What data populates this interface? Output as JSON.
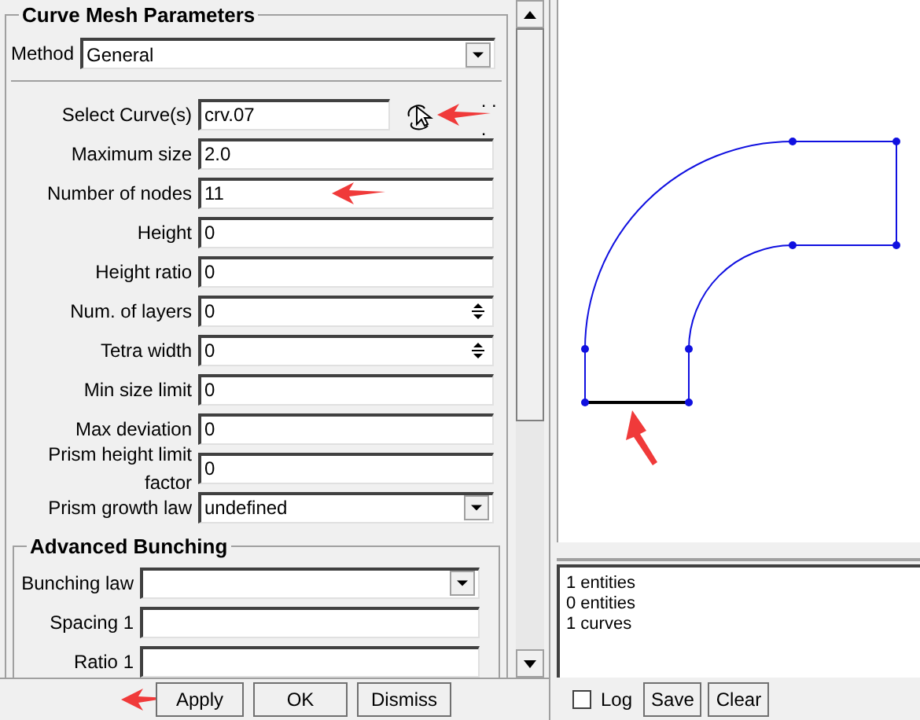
{
  "panel": {
    "title": "Curve Mesh Parameters",
    "method": {
      "label": "Method",
      "value": "General"
    },
    "fields": [
      {
        "kind": "select-curve",
        "label": "Select Curve(s)",
        "value": "crv.07",
        "dots": ". . ."
      },
      {
        "kind": "text",
        "label": "Maximum size",
        "value": "2.0"
      },
      {
        "kind": "text",
        "label": "Number of nodes",
        "value": "11"
      },
      {
        "kind": "text",
        "label": "Height",
        "value": "0"
      },
      {
        "kind": "text",
        "label": "Height ratio",
        "value": "0"
      },
      {
        "kind": "spin",
        "label": "Num. of layers",
        "value": "0"
      },
      {
        "kind": "spin",
        "label": "Tetra width",
        "value": "0"
      },
      {
        "kind": "text",
        "label": "Min size limit",
        "value": "0"
      },
      {
        "kind": "text",
        "label": "Max deviation",
        "value": "0"
      },
      {
        "kind": "text",
        "label": "Prism height limit factor",
        "value": "0"
      },
      {
        "kind": "combo",
        "label": "Prism growth law",
        "value": "undefined"
      }
    ],
    "advanced": {
      "title": "Advanced Bunching",
      "fields": [
        {
          "kind": "combo",
          "label": "Bunching law"
        },
        {
          "kind": "text",
          "label": "Spacing 1"
        },
        {
          "kind": "text",
          "label": "Ratio 1"
        }
      ]
    },
    "buttons": [
      "Apply",
      "OK",
      "Dismiss"
    ]
  },
  "messages": [
    "1 entities",
    "0 entities",
    "1 curves"
  ],
  "log": {
    "label": "Log",
    "checked": false
  },
  "message_buttons": [
    "Save",
    "Clear"
  ]
}
